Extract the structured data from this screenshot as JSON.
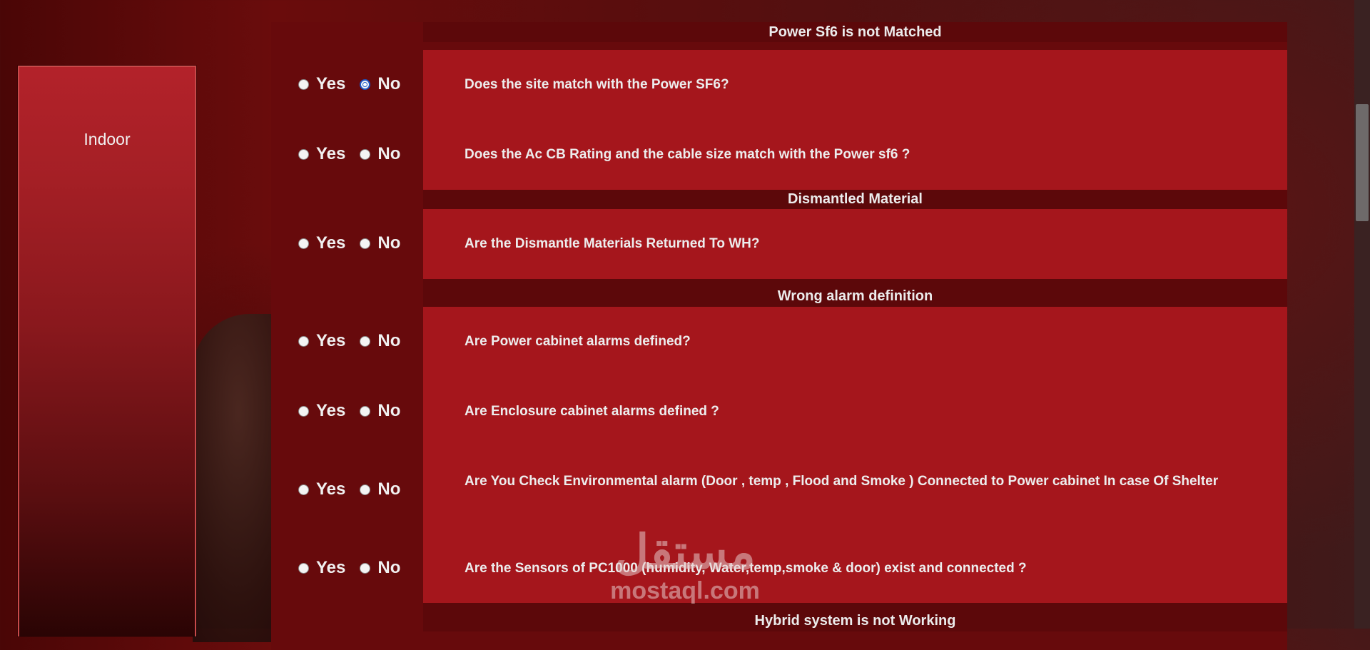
{
  "sidebar": {
    "title": "Indoor"
  },
  "sections": [
    {
      "header": "Power Sf6 is not Matched"
    },
    {
      "header": "Dismantled Material"
    },
    {
      "header": "Wrong alarm definition"
    },
    {
      "header": "Hybrid system is not Working"
    }
  ],
  "radio_labels": {
    "yes": "Yes",
    "no": "No"
  },
  "questions": [
    {
      "text": "Does the site match with the Power SF6?",
      "selected": "No"
    },
    {
      "text": "Does the Ac CB Rating and the cable size match with the Power sf6 ?",
      "selected": ""
    },
    {
      "text": "Are the Dismantle Materials Returned To WH?",
      "selected": ""
    },
    {
      "text": "Are Power cabinet alarms defined?",
      "selected": ""
    },
    {
      "text": "Are Enclosure cabinet alarms defined ?",
      "selected": ""
    },
    {
      "text": "Are You Check Environmental alarm (Door , temp , Flood and Smoke ) Connected to Power cabinet In case Of Shelter",
      "selected": ""
    },
    {
      "text": "Are the Sensors of PC1000 (humidity, Water,temp,smoke & door) exist and connected ?",
      "selected": ""
    }
  ],
  "watermark": {
    "arabic": "مستقل",
    "latin": "mostaql.com"
  },
  "colors": {
    "panel": "#670a0c",
    "content": "#a5161c",
    "header": "#5c080a",
    "sidebar_top": "#b3222a"
  }
}
